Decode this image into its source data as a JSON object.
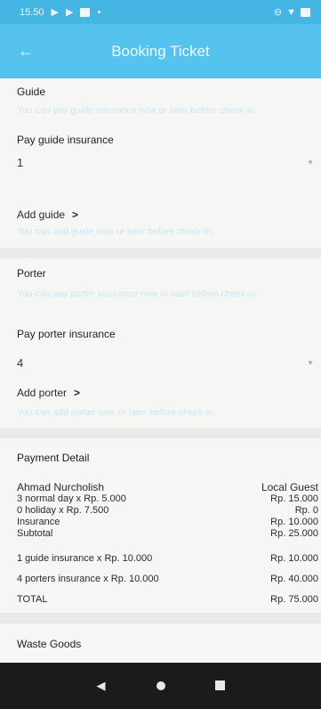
{
  "status_bar": {
    "time": "15.50",
    "icons_left": [
      "play-icon",
      "play-icon",
      "message-icon"
    ],
    "icons_right": [
      "minus-circle-icon",
      "wifi-icon",
      "battery-icon"
    ]
  },
  "app_bar": {
    "title": "Booking Ticket",
    "back_icon": "arrow-left-icon"
  },
  "guide": {
    "title": "Guide",
    "hint": "You can pay guide insurance now or later before check-in.",
    "pay_label": "Pay guide insurance",
    "selected": "1",
    "add_label": "Add guide",
    "add_hint": "You can add guide now or later before check-in."
  },
  "porter": {
    "title": "Porter",
    "hint": "You can pay porter insurance now or later before check-in.",
    "pay_label": "Pay porter insurance",
    "selected": "4",
    "add_label": "Add porter",
    "add_hint": "You can add porter now or later before check-in."
  },
  "payment": {
    "title": "Payment Detail",
    "name": "Ahmad Nurcholish",
    "guest_type": "Local Guest",
    "rows": [
      {
        "label": "3 normal day x Rp. 5.000",
        "value": "Rp. 15.000"
      },
      {
        "label": "0 holiday x Rp. 7.500",
        "value": "Rp. 0"
      },
      {
        "label": "Insurance",
        "value": "Rp. 10.000"
      },
      {
        "label": "Subtotal",
        "value": "Rp. 25.000"
      }
    ],
    "extras": [
      {
        "label": "1 guide insurance x Rp. 10.000",
        "value": "Rp. 10.000"
      },
      {
        "label": "4 porters insurance x Rp. 10.000",
        "value": "Rp. 40.000"
      },
      {
        "label": "TOTAL",
        "value": "Rp. 75.000"
      }
    ]
  },
  "waste": {
    "title": "Waste Goods"
  },
  "nav": {
    "back": "◀",
    "home": "home-icon",
    "recent": "recent-apps-icon"
  },
  "colors": {
    "status_bar": "#45b5e4",
    "app_bar": "#56c3ee",
    "hint_text": "#c8e6f3",
    "nav_bar": "#1b1b1b"
  }
}
